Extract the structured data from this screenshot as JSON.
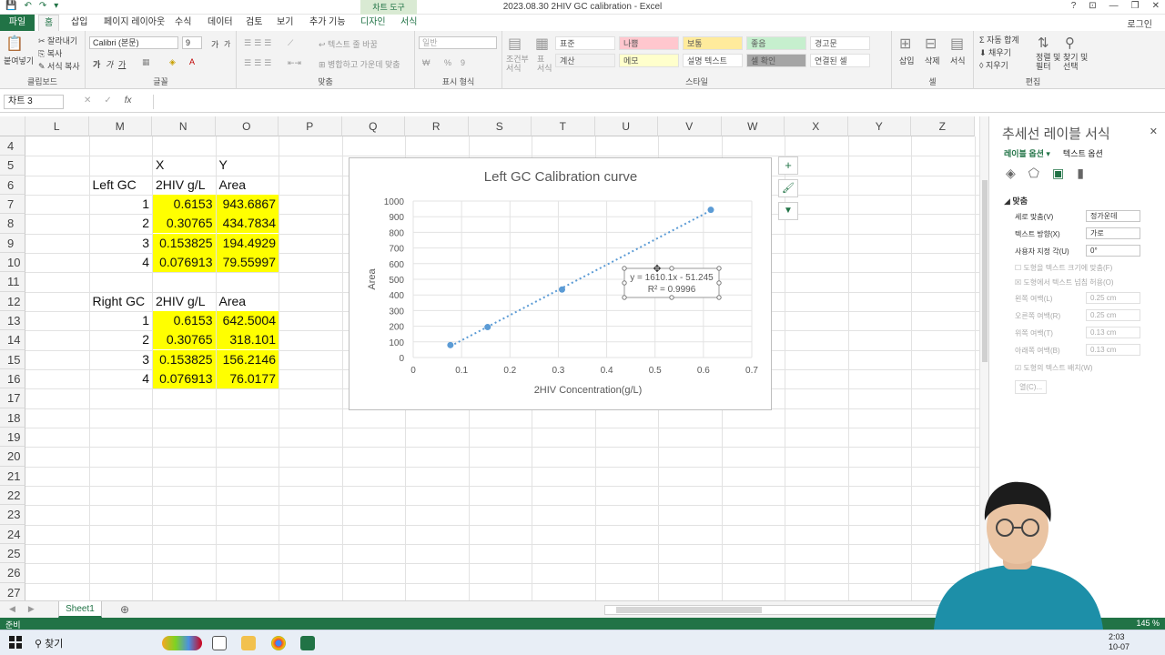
{
  "titlebar": {
    "doc_title": "2023.08.30 2HIV GC calibration - Excel",
    "context_tab": "차트 도구",
    "help": "?",
    "ribbon_opts": "⊡",
    "minimize": "—",
    "restore": "❐",
    "close": "✕"
  },
  "tabs": {
    "file": "파일",
    "home": "홈",
    "insert": "삽입",
    "page_layout": "페이지 레이아웃",
    "formulas": "수식",
    "data": "데이터",
    "review": "검토",
    "view": "보기",
    "addins": "추가 기능",
    "design": "디자인",
    "format": "서식",
    "login": "로그인"
  },
  "ribbon": {
    "clipboard": {
      "label": "클립보드",
      "paste": "붙여넣기",
      "cut": "잘라내기",
      "copy": "복사",
      "format_painter": "서식 복사"
    },
    "font": {
      "label": "글꼴",
      "name": "Calibri (본문)",
      "size": "9",
      "grow": "가",
      "shrink": "가",
      "bold": "가",
      "italic": "가",
      "underline": "가"
    },
    "alignment": {
      "label": "맞춤",
      "wrap": "텍스트 줄 바꿈",
      "merge": "병합하고 가운데 맞춤"
    },
    "number": {
      "label": "표시 형식",
      "format": "일반",
      "percent": "%",
      "comma": "9"
    },
    "styles": {
      "label": "스타일",
      "conditional": "조건부\n서식",
      "table": "표\n서식",
      "cells": [
        [
          "표준",
          "나쁨",
          "보통",
          "좋음",
          "경고문"
        ],
        [
          "계산",
          "메모",
          "설명 텍스트",
          "셀 확인",
          "연결된 셀"
        ]
      ]
    },
    "cells": {
      "label": "셀",
      "insert": "삽입",
      "delete": "삭제",
      "format": "서식"
    },
    "editing": {
      "label": "편집",
      "autosum": "자동 합계",
      "fill": "채우기",
      "clear": "지우기",
      "sort": "정렬 및\n필터",
      "find": "찾기 및\n선택"
    }
  },
  "formula_bar": {
    "name_box": "차트 3",
    "fx": "fx",
    "cancel": "✕",
    "enter": "✓"
  },
  "grid": {
    "columns": [
      "L",
      "M",
      "N",
      "O",
      "P",
      "Q",
      "R",
      "S",
      "T",
      "U",
      "V",
      "W",
      "X",
      "Y",
      "Z"
    ],
    "rows": [
      "4",
      "5",
      "6",
      "7",
      "8",
      "9",
      "10",
      "11",
      "12",
      "13",
      "14",
      "15",
      "16",
      "17",
      "18",
      "19",
      "20",
      "21",
      "22",
      "23",
      "24",
      "25",
      "26",
      "27"
    ],
    "header_x": "X",
    "header_y": "Y",
    "left_label": "Left GC",
    "right_label": "Right GC",
    "col_conc": "2HIV g/L",
    "col_area": "Area",
    "left": [
      {
        "n": "1",
        "conc": "0.6153",
        "area": "943.6867"
      },
      {
        "n": "2",
        "conc": "0.30765",
        "area": "434.7834"
      },
      {
        "n": "3",
        "conc": "0.153825",
        "area": "194.4929"
      },
      {
        "n": "4",
        "conc": "0.076913",
        "area": "79.55997"
      }
    ],
    "right": [
      {
        "n": "1",
        "conc": "0.6153",
        "area": "642.5004"
      },
      {
        "n": "2",
        "conc": "0.30765",
        "area": "318.101"
      },
      {
        "n": "3",
        "conc": "0.153825",
        "area": "156.2146"
      },
      {
        "n": "4",
        "conc": "0.076913",
        "area": "76.0177"
      }
    ],
    "highlight_color": "#ffff00"
  },
  "chart_data": {
    "type": "scatter",
    "title": "Left GC Calibration curve",
    "xlabel": "2HIV Concentration(g/L)",
    "ylabel": "Area",
    "xlim": [
      0,
      0.7
    ],
    "ylim": [
      0,
      1000
    ],
    "x_ticks": [
      "0",
      "0.1",
      "0.2",
      "0.3",
      "0.4",
      "0.5",
      "0.6",
      "0.7"
    ],
    "y_ticks": [
      "0",
      "100",
      "200",
      "300",
      "400",
      "500",
      "600",
      "700",
      "800",
      "900",
      "1000"
    ],
    "grid": true,
    "series": [
      {
        "x": [
          0.6153,
          0.30765,
          0.153825,
          0.076913
        ],
        "y": [
          943.6867,
          434.7834,
          194.4929,
          79.55997
        ],
        "color": "#5b9bd5"
      }
    ],
    "trendline": {
      "slope": 1610.1,
      "intercept": -51.245,
      "equation": "y = 1610.1x - 51.245",
      "r2": "R² = 0.9996",
      "color": "#5b9bd5"
    }
  },
  "chart_buttons": {
    "elements": "+",
    "styles": "🖌",
    "filters": "▼"
  },
  "sheets": {
    "active": "Sheet1",
    "add": "⊕",
    "prev": "◀",
    "next": "▶"
  },
  "status": {
    "ready": "준비",
    "zoom": "145 %"
  },
  "taskbar": {
    "search": "찾기",
    "time": "2:03",
    "date": "10-07"
  },
  "pane": {
    "title": "추세선 레이블 서식",
    "close": "✕",
    "tab_label_options": "레이블 옵션 ▾",
    "tab_text_options": "텍스트 옵션",
    "section": "◢ 맞춤",
    "rows": [
      {
        "label": "세로 맞춤(V)",
        "value": "정가운데"
      },
      {
        "label": "텍스트 방향(X)",
        "value": "가로"
      },
      {
        "label": "사용자 지정 각(U)",
        "value": "0°"
      }
    ],
    "check1": "☐ 도형을 텍스트 크기에 맞춤(F)",
    "check2": "☒ 도형에서 텍스트 넘침 허용(O)",
    "margins": [
      {
        "label": "왼쪽 여백(L)",
        "value": "0.25 cm"
      },
      {
        "label": "오른쪽 여백(R)",
        "value": "0.25 cm"
      },
      {
        "label": "위쪽 여백(T)",
        "value": "0.13 cm"
      },
      {
        "label": "아래쪽 여백(B)",
        "value": "0.13 cm"
      }
    ],
    "check3": "☑ 도형의 텍스트 배치(W)",
    "columns_btn": "열(C)..."
  }
}
